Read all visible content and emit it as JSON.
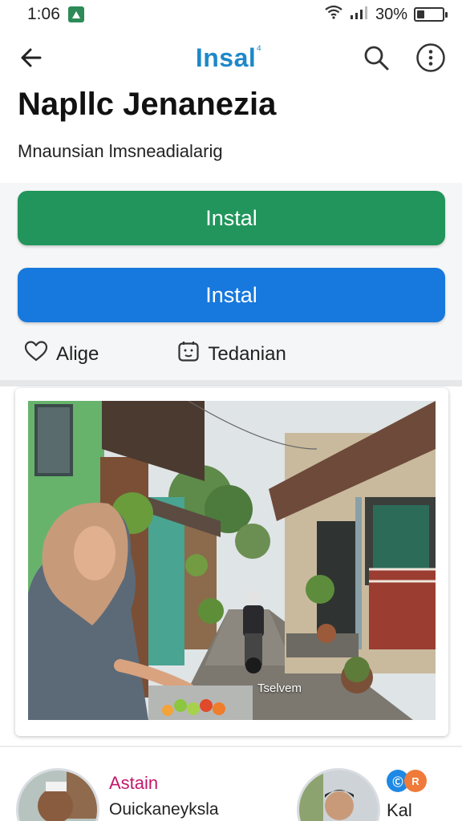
{
  "status": {
    "time": "1:06",
    "battery_text": "30%",
    "battery_level": 0.3
  },
  "app_bar": {
    "title": "Insal",
    "title_mark": "⁴"
  },
  "header": {
    "title": "Napllc Jenanezia",
    "subtitle": "Mnaunsian lmsneadialarig"
  },
  "actions": {
    "primary_label": "Instal",
    "secondary_label": "Instal",
    "like_label": "Alige",
    "tag_label": "Tedanian"
  },
  "photo": {
    "caption": "Tselvem"
  },
  "profiles": [
    {
      "name": "Astain",
      "subtitle": "Ouickaneyksla"
    },
    {
      "subtitle": "Kal",
      "chip_a": "Ⓒ",
      "chip_b": "R"
    }
  ],
  "colors": {
    "title_blue": "#1e88c8",
    "button_green": "#21955b",
    "button_blue": "#1778dd",
    "profile_name_pink": "#c2186b"
  },
  "icons": {
    "back": "arrow-left",
    "search": "magnifier",
    "more": "vertical-dots",
    "like": "heart-outline",
    "tag": "face-square"
  }
}
